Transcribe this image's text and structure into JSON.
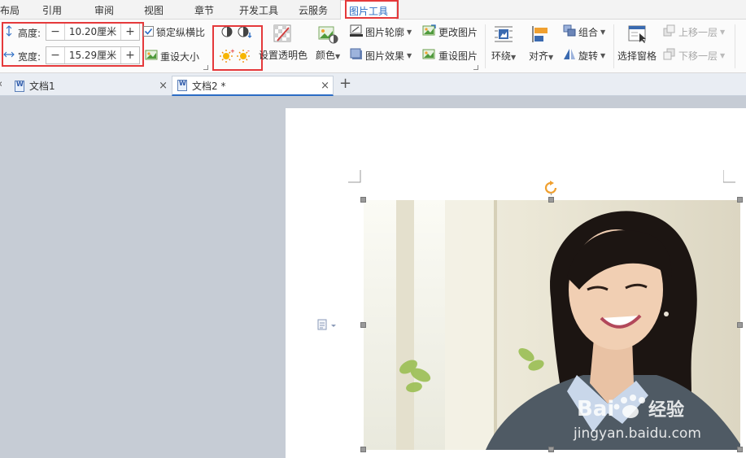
{
  "ribbon_tabs": [
    "布局",
    "引用",
    "审阅",
    "视图",
    "章节",
    "开发工具",
    "云服务",
    "图片工具"
  ],
  "active_tab": "图片工具",
  "size": {
    "height_label": "高度:",
    "height_value": "10.20厘米",
    "width_label": "宽度:",
    "width_value": "15.29厘米",
    "minus": "−",
    "plus": "+"
  },
  "lock_ratio": {
    "label": "锁定纵横比",
    "checked": true
  },
  "reset_size": "重设大小",
  "set_transparent": "设置透明色",
  "color": "颜色",
  "picture_outline": "图片轮廓",
  "picture_effects": "图片效果",
  "change_picture": "更改图片",
  "reset_picture": "重设图片",
  "wrap": "环绕",
  "align": "对齐",
  "group": "组合",
  "rotate": "旋转",
  "selection_pane": "选择窗格",
  "bring_forward": "上移一层",
  "send_backward": "下移一层",
  "doc_tabs": [
    {
      "title": "文档1",
      "active": false
    },
    {
      "title": "文档2 *",
      "active": true
    }
  ],
  "new_tab": "+",
  "watermark": {
    "brand": "Bai",
    "brand_cn": "经验",
    "url": "jingyan.baidu.com"
  },
  "colors": {
    "accent": "#2b6cc4",
    "highlight_box": "#e5393b",
    "orange": "#f0a030"
  }
}
